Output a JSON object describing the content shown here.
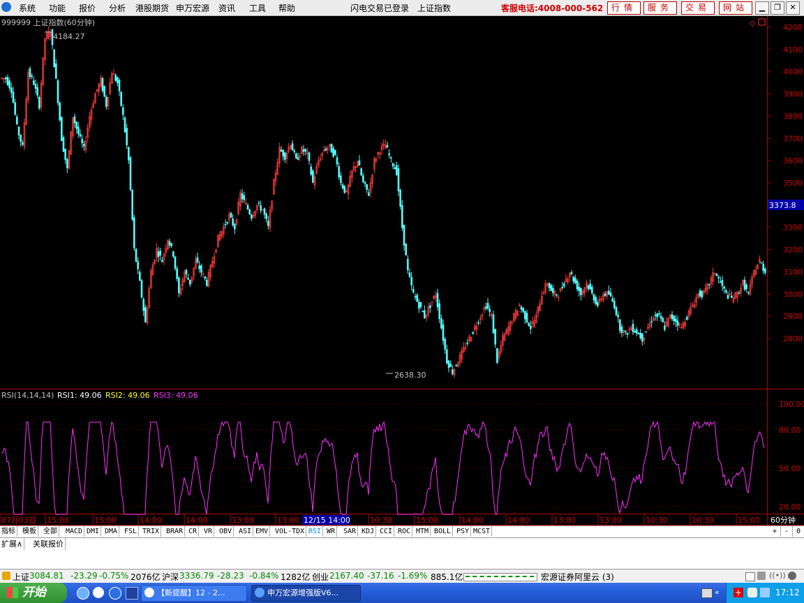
{
  "menu": {
    "items": [
      "系统",
      "功能",
      "报价",
      "分析",
      "港股期货",
      "申万宏源",
      "资讯",
      "工具",
      "帮助"
    ],
    "login_status": "闪电交易已登录",
    "current_index": "上证指数",
    "service_phone": "客服电话:4008-000-562",
    "service_buttons": [
      "行情",
      "服务",
      "交易",
      "网站"
    ]
  },
  "chart": {
    "title": "999999 上证指数(60分钟)",
    "high_label": "4184.27",
    "low_label": "2638.30",
    "current_price": "3373.8",
    "price_ticks": [
      "4200",
      "4100",
      "4000",
      "3900",
      "3800",
      "3700",
      "3600",
      "3500",
      "3300",
      "3200",
      "3100",
      "3000",
      "2900",
      "2800"
    ],
    "rsi_header": "RSI(14,14,14)",
    "rsi1_label": "RSI1: 49.06",
    "rsi2_label": "RSI2: 49.06",
    "rsi3_label": "RSI3: 49.06",
    "rsi_ticks": [
      "100.00",
      "80.00",
      "50.00",
      "20.00"
    ],
    "time_labels": [
      "07月03日",
      "15:00",
      "15:00",
      "14:00",
      "14:00",
      "13:00",
      "13:00",
      "12/15 14:00",
      "10:30",
      "15:00",
      "14:00",
      "14:00",
      "13:00",
      "13:00",
      "10:30",
      "10:30",
      "15:00"
    ],
    "period": "60分钟"
  },
  "colors": {
    "up": "#ff3b3b",
    "down": "#54ffff",
    "rsi": "#ff30ff",
    "axis": "#b20000",
    "rsi2": "#ffff30"
  },
  "chart_data": {
    "type": "candlestick",
    "title": "999999 上证指数(60分钟)",
    "ylim": [
      2600,
      4250
    ],
    "approx_close_path": [
      3970,
      3920,
      3750,
      3660,
      4000,
      3950,
      3850,
      4150,
      4184,
      3960,
      3700,
      3560,
      3800,
      3720,
      3650,
      3800,
      3900,
      3960,
      3850,
      4000,
      3950,
      3800,
      3600,
      3200,
      3050,
      2870,
      3100,
      3200,
      3150,
      3250,
      3180,
      3000,
      3100,
      3050,
      3150,
      3100,
      3050,
      3150,
      3250,
      3300,
      3350,
      3300,
      3450,
      3400,
      3350,
      3400,
      3380,
      3300,
      3500,
      3650,
      3620,
      3680,
      3600,
      3650,
      3630,
      3500,
      3600,
      3650,
      3660,
      3620,
      3500,
      3450,
      3550,
      3600,
      3500,
      3450,
      3600,
      3650,
      3670,
      3600,
      3550,
      3300,
      3100,
      3000,
      2950,
      2900,
      2950,
      3000,
      2850,
      2700,
      2650,
      2700,
      2750,
      2800,
      2850,
      2900,
      2950,
      2900,
      2700,
      2800,
      2850,
      2900,
      2950,
      2900,
      2850,
      2900,
      3000,
      3050,
      3000,
      3000,
      3050,
      3100,
      3050,
      3000,
      3050,
      3000,
      2950,
      3000,
      3000,
      2950,
      2850,
      2820,
      2850,
      2830,
      2800,
      2850,
      2900,
      2900,
      2850,
      2900,
      2880,
      2850,
      2900,
      2950,
      3000,
      3000,
      3050,
      3100,
      3050,
      3000,
      2980,
      3000,
      3050,
      3000,
      3100,
      3150,
      3100
    ],
    "rsi": {
      "value": 49.06,
      "ylim": [
        0,
        100
      ]
    }
  },
  "tabs": {
    "items": [
      "指标",
      "模板",
      "全部",
      "MACD",
      "DMI",
      "DMA",
      "FSL",
      "TRIX",
      "BRAR",
      "CR",
      "VR",
      "OBV",
      "ASI",
      "EMV",
      "VOL-TDX",
      "RSI",
      "WR",
      "SAR",
      "KDJ",
      "CCI",
      "ROC",
      "MTM",
      "BOLL",
      "PSY",
      "MCST"
    ],
    "selected": "RSI",
    "right_buttons": [
      "+",
      "-",
      "0"
    ],
    "row2": [
      "扩展∧",
      "关联报价"
    ]
  },
  "status": {
    "sh_name": "上证",
    "sh_value": "3084.81",
    "sh_change": "-23.29",
    "sh_pct": "-0.75%",
    "sh_vol": "2076亿",
    "hs_name": "沪深",
    "hs_value": "3336.79",
    "hs_change": "-28.23",
    "hs_pct": "-0.84%",
    "hs_vol": "1282亿",
    "cy_name": "创业",
    "cy_value": "2167.40",
    "cy_change": "-37.16",
    "cy_pct": "-1.69%",
    "cy_vol": "885.1亿",
    "broker": "宏源证券阿里云 (3)"
  },
  "taskbar": {
    "start_label": "开始",
    "task1": "【新提醒】12 - 2...",
    "task2": "申万宏源增强版V6...",
    "clock": "17:12"
  }
}
